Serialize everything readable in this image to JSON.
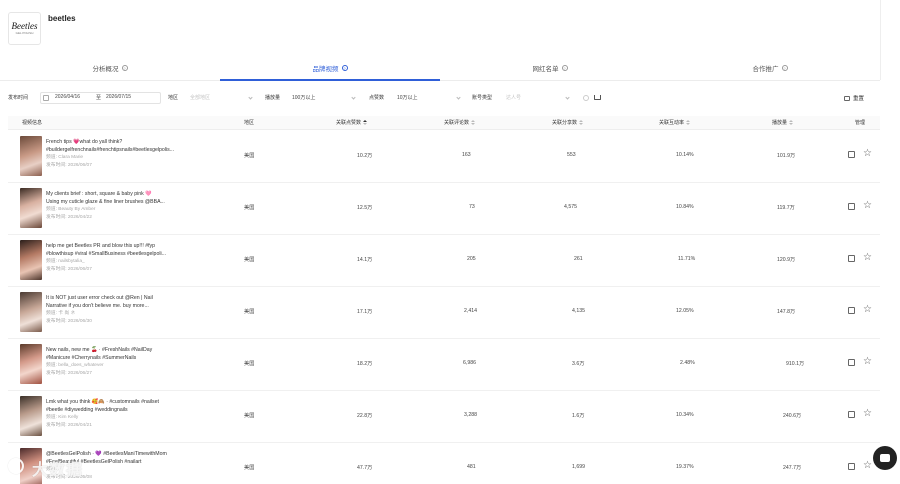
{
  "brand": {
    "name": "beetles",
    "logo_text": "Beetles",
    "logo_sub": "GEL POLISH"
  },
  "tabs": [
    {
      "label": "分析概况",
      "active": false
    },
    {
      "label": "品牌视频",
      "active": true
    },
    {
      "label": "网红名单",
      "active": false
    },
    {
      "label": "合作推广",
      "active": false
    }
  ],
  "filters": {
    "publish_time_label": "发布时间",
    "date_start": "2026/04/16",
    "date_separator": "至",
    "date_end": "2026/07/15",
    "region_label": "地区",
    "region_placeholder": "全部地区",
    "views_label": "播放量",
    "views_value": "100万以上",
    "likes_label": "点赞数",
    "likes_value": "10万以上",
    "account_type_label": "账号类型",
    "account_type_placeholder": "达人号",
    "reset_label": "重置"
  },
  "table": {
    "headers": {
      "video_info": "视频信息",
      "region": "地区",
      "likes": "关联点赞数",
      "comments": "关联评论数",
      "shares": "关联分享数",
      "engagement": "关联互动率",
      "views": "播放量",
      "manage": "管理"
    },
    "channel_label": "频道",
    "publish_label": "发布时间",
    "rows": [
      {
        "line1": "French tips 💗what do yall think?",
        "line2": "#buildergelfrenchnails#frenchtipsnails#beetlesgelpolis...",
        "channel": "Clara Marie",
        "date": "2026/06/07",
        "region": "美国",
        "likes": "10.2万",
        "comments": "163",
        "shares": "553",
        "engagement": "10.14%",
        "views": "101.9万"
      },
      {
        "line1": "My clients brief : short, square & baby pink 🩷",
        "line2": "Using my cuticle glaze & fine liner brushes @BBA...",
        "channel": "Beauty By Amber",
        "date": "2026/04/22",
        "region": "美国",
        "likes": "12.5万",
        "comments": "73",
        "shares": "4,575",
        "engagement": "10.84%",
        "views": "119.7万"
      },
      {
        "line1": "help me get Beetles PR and blow this up!!! #fyp",
        "line2": "#blowthisup #viral #SmallBusiness #beetlesgelpoli...",
        "channel": "nailsbytalia_",
        "date": "2026/06/07",
        "region": "美国",
        "likes": "14.1万",
        "comments": "205",
        "shares": "261",
        "engagement": "11.71%",
        "views": "120.9万"
      },
      {
        "line1": "It is NOT just user error check out @Ren | Nail",
        "line2": "Narrative if you don't believe me. buy more...",
        "channel": "卡 尚 ネ",
        "date": "2026/06/30",
        "region": "美国",
        "likes": "17.1万",
        "comments": "2,414",
        "shares": "4,135",
        "engagement": "12.05%",
        "views": "147.8万"
      },
      {
        "line1": "New nails, new me 🍒 · #FreshNails #NailDay",
        "line2": "#Manicure #Cherrynails #SummerNails",
        "channel": "bella_does_whatever",
        "date": "2026/06/27",
        "region": "美国",
        "likes": "18.2万",
        "comments": "6,986",
        "shares": "3.6万",
        "engagement": "2.48%",
        "views": "910.1万"
      },
      {
        "line1": "Lmk what you think 🥰🙈 · #customnails #nailset",
        "line2": "#beetle #diywedding #weddingnails",
        "channel": "Kim Kelly",
        "date": "2026/04/21",
        "region": "美国",
        "likes": "22.8万",
        "comments": "3,288",
        "shares": "1.6万",
        "engagement": "10.34%",
        "views": "240.6万"
      },
      {
        "line1": "@BeetlesGelPolish · 💜 #BeetlesManiTimewithMom",
        "line2": "#FeelBeautiful #BeetlesGelPolish #nailart",
        "channel": "",
        "date": "2026/05/08",
        "region": "美国",
        "likes": "47.7万",
        "comments": "481",
        "shares": "1,699",
        "engagement": "19.37%",
        "views": "247.7万"
      }
    ]
  },
  "watermark": "大数据",
  "icons": {
    "tab_help": "question-circle-icon",
    "calendar": "calendar-icon",
    "reset": "reset-icon",
    "cart": "cart-icon",
    "manage_doc": "document-icon",
    "manage_star": "star-icon",
    "chat": "chat-icon"
  },
  "colors": {
    "accent": "#2f5fd8"
  }
}
